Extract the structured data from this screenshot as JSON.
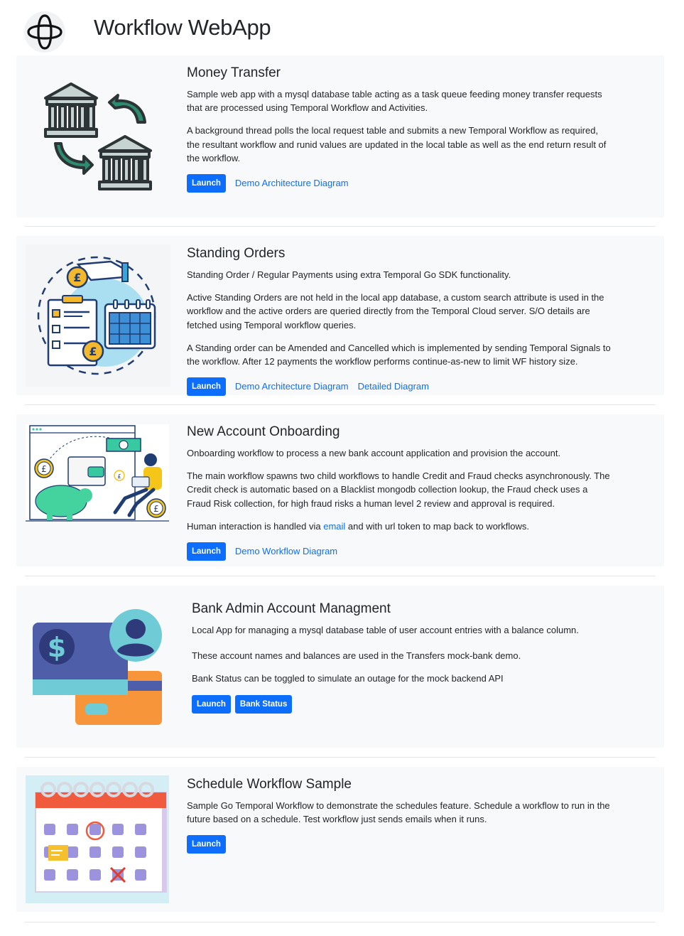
{
  "app": {
    "title": "Workflow WebApp",
    "logo_icon": "temporal-logo-icon"
  },
  "cards": [
    {
      "title": "Money Transfer",
      "icon": "bank-transfer-icon",
      "paragraphs": [
        "Sample web app with a mysql database table acting as a task queue feeding money transfer requests that are processed using Temporal Workflow and Activities.",
        "A background thread polls the local request table and submits a new Temporal Workflow as required, the resultant workflow and runid values are updated in the local table as well as the end return result of the workflow."
      ],
      "buttons": [
        "Launch"
      ],
      "links": [
        "Demo Architecture Diagram"
      ]
    },
    {
      "title": "Standing Orders",
      "icon": "standing-orders-icon",
      "paragraphs": [
        "Standing Order / Regular Payments using extra Temporal Go SDK functionality.",
        "Active Standing Orders are not held in the local app database, a custom search attribute is used in the workflow and the active orders are queried directly from the Temporal Cloud server. S/O details are fetched using Temporal workflow queries.",
        "A Standing order can be Amended and Cancelled which is implemented by sending Temporal Signals to the workflow. After 12 payments the workflow performs continue-as-new to limit WF history size."
      ],
      "buttons": [
        "Launch"
      ],
      "links": [
        "Demo Architecture Diagram",
        "Detailed Diagram"
      ]
    },
    {
      "title": "New Account Onboarding",
      "icon": "onboarding-icon",
      "paragraphs": [
        "Onboarding workflow to process a new bank account application and provision the account.",
        "The main workflow spawns two child workflows to handle Credit and Fraud checks asynchronously. The Credit check is automatic based on a Blacklist mongodb collection lookup, the Fraud check uses a Fraud Risk collection, for high fraud risks a human level 2 review and approval is required."
      ],
      "human": {
        "before": "Human interaction is handled via ",
        "link": "email",
        "after": " and with url token to map back to workflows."
      },
      "buttons": [
        "Launch"
      ],
      "links": [
        "Demo Workflow Diagram"
      ]
    },
    {
      "title": "Bank Admin Account Managment",
      "icon": "account-card-icon",
      "paragraphs": [
        "Local App for managing a mysql database table of user account entries with a balance column.",
        "These account names and balances are used in the Transfers mock-bank demo.",
        "Bank Status can be toggled to simulate an outage for the mock backend API"
      ],
      "buttons": [
        "Launch",
        "Bank Status"
      ],
      "links": []
    },
    {
      "title": "Schedule Workflow Sample",
      "icon": "calendar-schedule-icon",
      "paragraphs": [
        "Sample Go Temporal Workflow to demonstrate the schedules feature. Schedule a workflow to run in the future based on a schedule. Test workflow just sends emails when it runs."
      ],
      "buttons": [
        "Launch"
      ],
      "links": []
    }
  ],
  "colors": {
    "accent": "#0d6efd",
    "card_bg": "#f8f9fa",
    "teal": "#2e8b6e",
    "bank_grey": "#c7d3d1"
  }
}
